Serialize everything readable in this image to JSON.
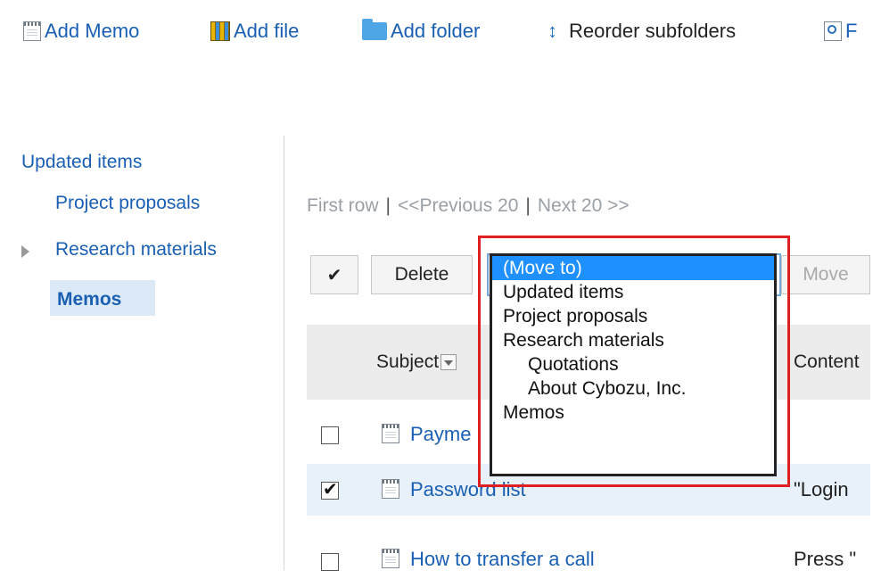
{
  "toolbar": {
    "add_memo": "Add Memo",
    "add_file": "Add file",
    "add_folder": "Add folder",
    "reorder": "Reorder subfolders",
    "find_partial": "F"
  },
  "sidebar": {
    "root": "Updated items",
    "items": [
      {
        "label": "Project proposals"
      },
      {
        "label": "Research materials",
        "collapsed": true
      },
      {
        "label": "Memos",
        "selected": true
      }
    ]
  },
  "pager": {
    "first": "First row",
    "prev": "<<Previous 20",
    "next": "Next 20 >>",
    "separator": "|"
  },
  "actions": {
    "check_all": "✔",
    "delete": "Delete",
    "move": "Move"
  },
  "move_dropdown": {
    "options": [
      {
        "label": "(Move to)",
        "selected": true
      },
      {
        "label": "Updated items"
      },
      {
        "label": "Project proposals"
      },
      {
        "label": "Research materials"
      },
      {
        "label": "Quotations",
        "indent": 1
      },
      {
        "label": "About Cybozu, Inc.",
        "indent": 1
      },
      {
        "label": "Memos"
      }
    ]
  },
  "table": {
    "headers": {
      "subject": "Subject",
      "content": "Content"
    },
    "rows": [
      {
        "subject": "Payme",
        "content": "",
        "checked": false
      },
      {
        "subject": "Password list",
        "content": "\"Login",
        "checked": true
      },
      {
        "subject": "How to transfer a call",
        "content": "Press \"",
        "checked": false
      }
    ]
  },
  "colors": {
    "link": "#1a5fb4",
    "highlight_frame": "#e02020",
    "selected_option": "#1e90ff",
    "selected_row": "#e8f1fa"
  }
}
